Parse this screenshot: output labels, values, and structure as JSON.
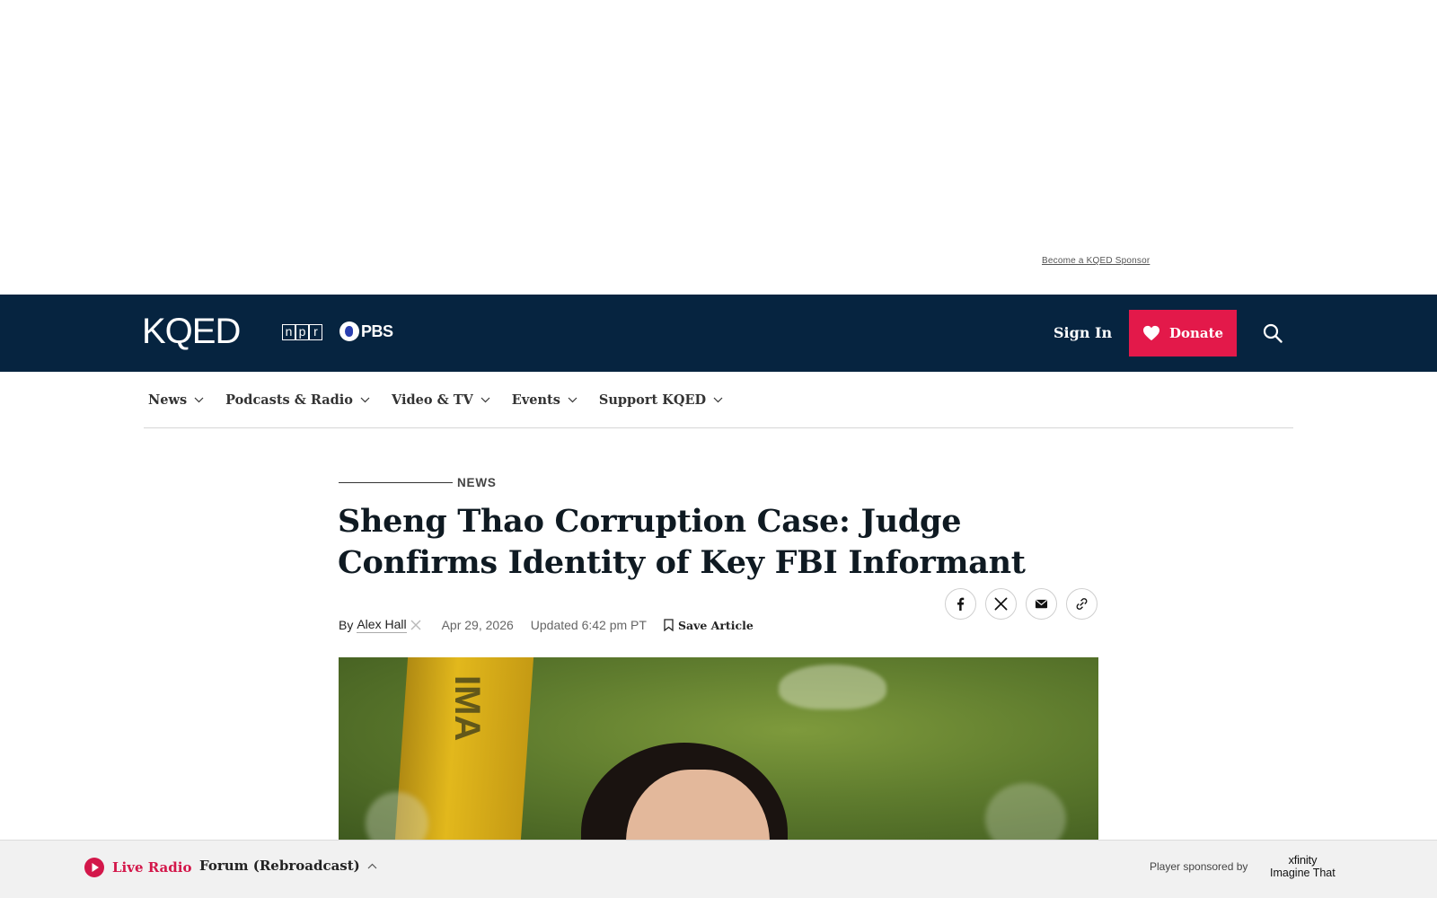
{
  "ad": {
    "sponsor_link": "Become a KQED Sponsor"
  },
  "header": {
    "logo": "KQED",
    "npr_letters": [
      "n",
      "p",
      "r"
    ],
    "pbs": "PBS",
    "sign_in": "Sign In",
    "donate": "Donate",
    "colors": {
      "background": "#062440",
      "donate": "#e3194a"
    }
  },
  "nav": {
    "items": [
      {
        "label": "News"
      },
      {
        "label": "Podcasts & Radio"
      },
      {
        "label": "Video & TV"
      },
      {
        "label": "Events"
      },
      {
        "label": "Support KQED"
      }
    ]
  },
  "article": {
    "kicker": "NEWS",
    "headline": "Sheng Thao Corruption Case: Judge Confirms Identity of Key FBI Informant",
    "byline_prefix": "By",
    "author": "Alex Hall",
    "date": "Apr 29, 2026",
    "updated": "Updated 6:42 pm PT",
    "save_article": "Save Article",
    "share": [
      "facebook-icon",
      "x-icon",
      "email-icon",
      "link-icon"
    ],
    "hero_flag_text": "IMA"
  },
  "player": {
    "live_radio": "Live Radio",
    "program": "Forum (Rebroadcast)",
    "sponsored_by": "Player sponsored by",
    "sponsor_line1": "xfinity",
    "sponsor_line2": "Imagine That",
    "accent": "#d3174a"
  }
}
